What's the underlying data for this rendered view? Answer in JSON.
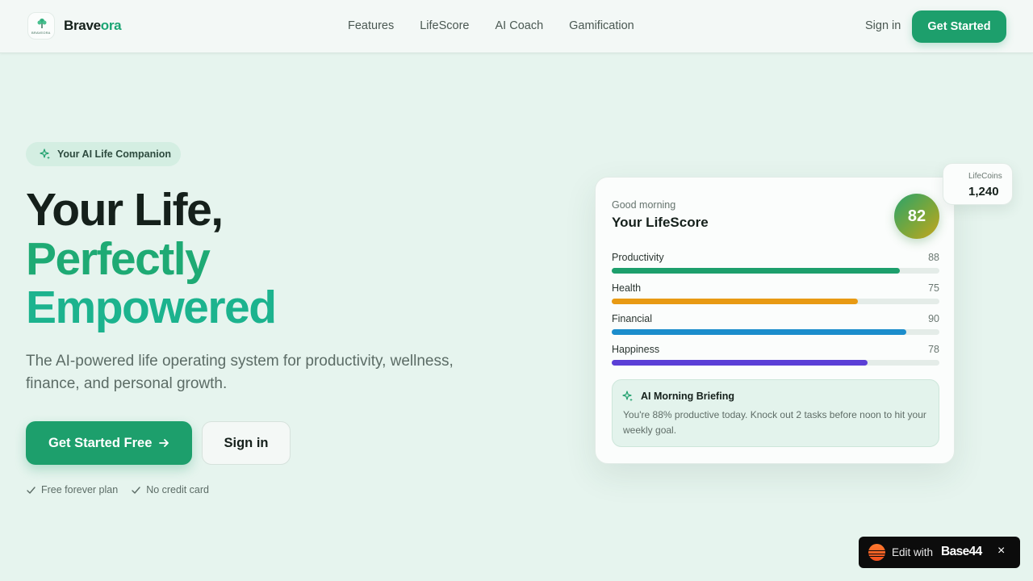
{
  "nav": {
    "logo_caption": "BRAVEORA",
    "brand_a": "Brave",
    "brand_b": "ora",
    "links": [
      "Features",
      "LifeScore",
      "AI Coach",
      "Gamification"
    ],
    "signin": "Sign in",
    "cta": "Get Started"
  },
  "hero": {
    "pill": "Your AI Life Companion",
    "title_line1": "Your Life,",
    "title_line2": "Perfectly",
    "title_line3": "Empowered",
    "subtitle": "The AI-powered life operating system for productivity, wellness, finance, and personal growth.",
    "primary_cta": "Get Started Free",
    "secondary_cta": "Sign in",
    "checks": [
      "Free forever plan",
      "No credit card"
    ]
  },
  "card": {
    "greeting": "Good morning",
    "title": "Your LifeScore",
    "score": "82",
    "metrics": [
      {
        "name": "Productivity",
        "value": "88",
        "fraction": 0.88,
        "color": "#1d9f6c"
      },
      {
        "name": "Health",
        "value": "75",
        "fraction": 0.75,
        "color": "#e89a13"
      },
      {
        "name": "Financial",
        "value": "90",
        "fraction": 0.9,
        "color": "#1b8dcc"
      },
      {
        "name": "Happiness",
        "value": "78",
        "fraction": 0.78,
        "color": "#5b3fd6"
      }
    ],
    "briefing_title": "AI Morning Briefing",
    "briefing_body": "You're 88% productive today. Knock out 2 tasks before noon to hit your weekly goal."
  },
  "coins": {
    "label": "LifeCoins",
    "value": "1,240"
  },
  "badge": {
    "edit_text": "Edit with",
    "brand": "Base44",
    "close": "×"
  },
  "colors": {
    "accent": "#1d9f6c",
    "background": "#e6f4ee"
  }
}
